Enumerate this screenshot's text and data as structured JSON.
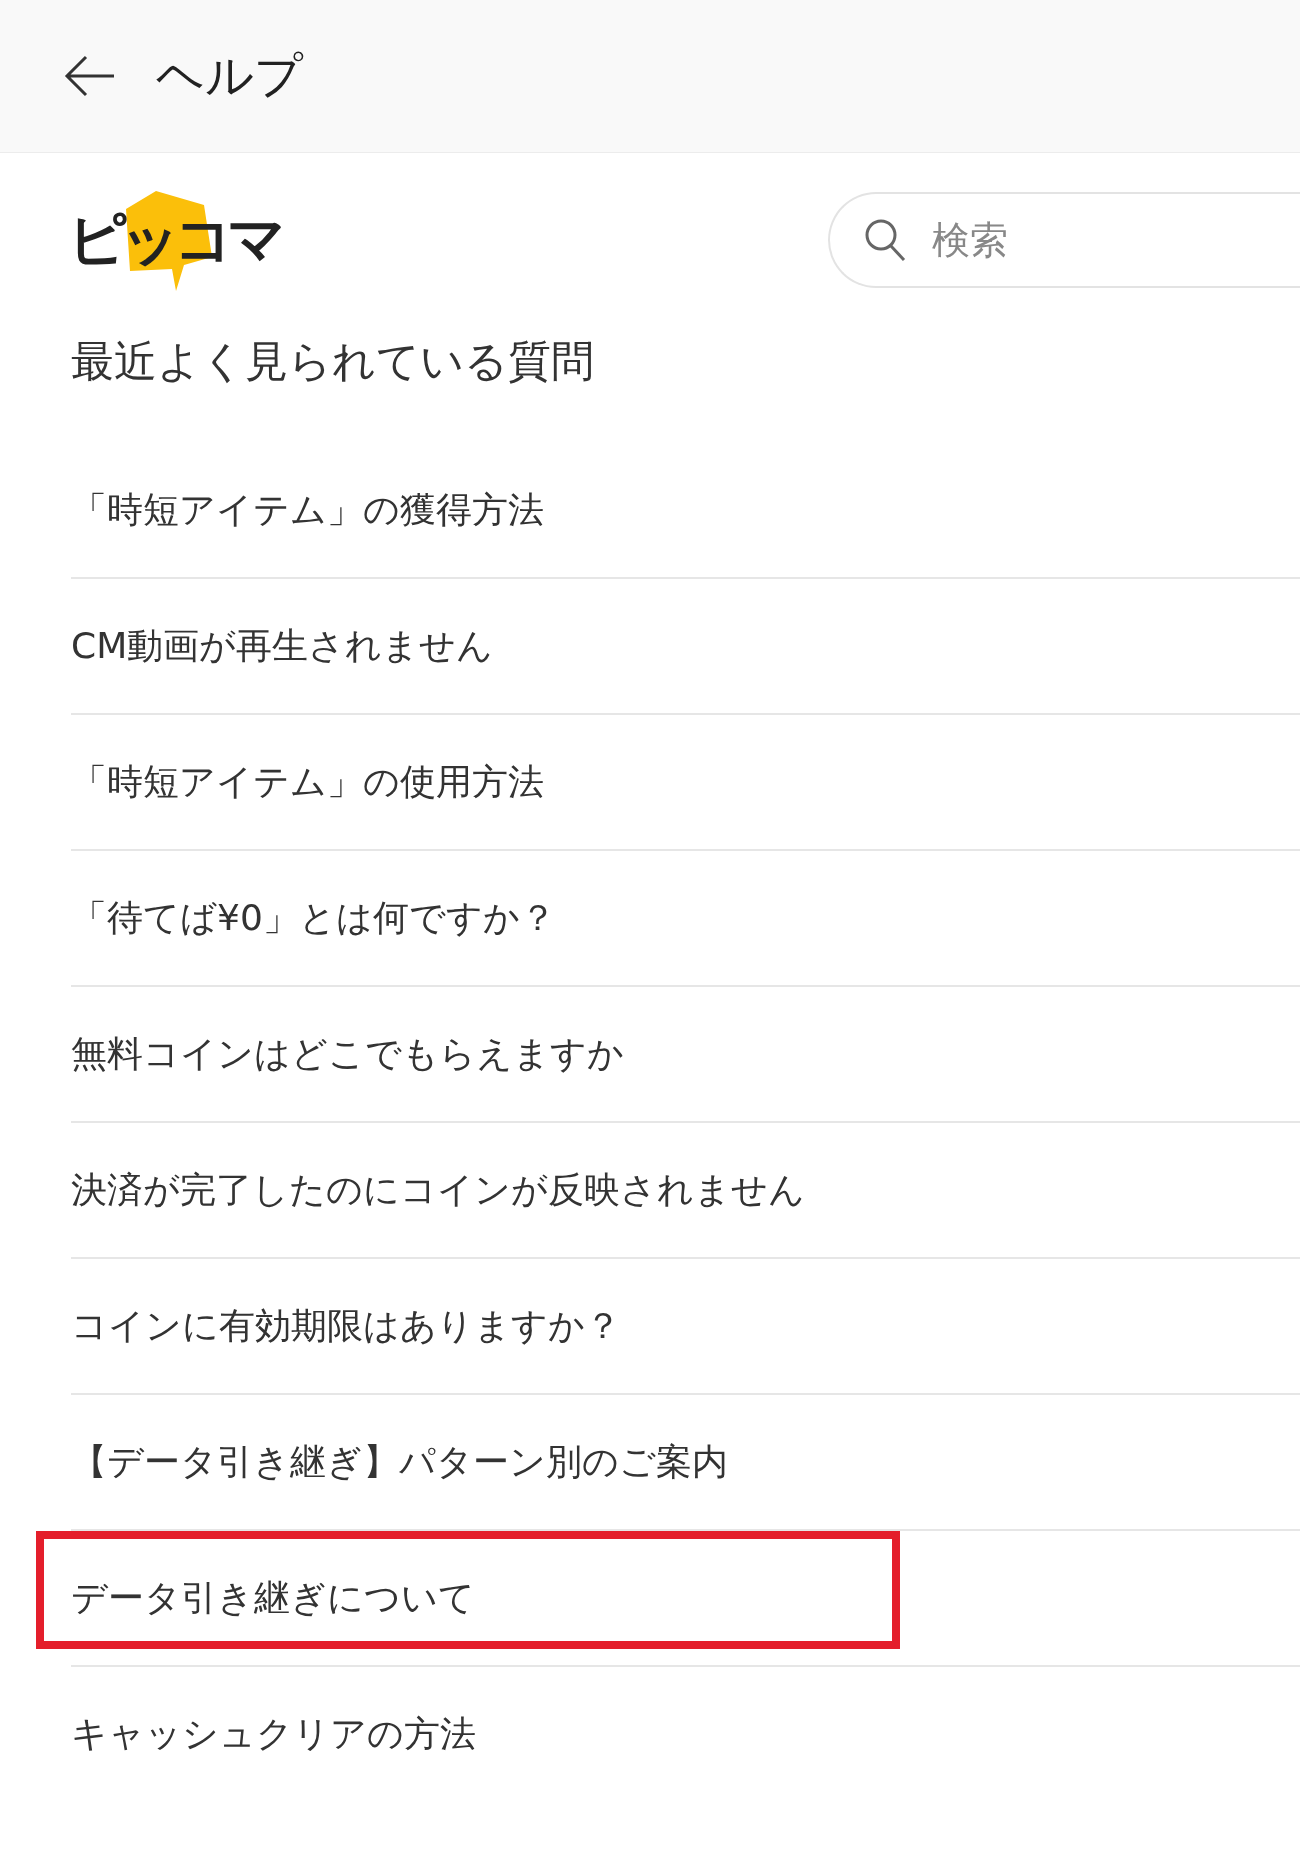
{
  "header": {
    "title": "ヘルプ"
  },
  "logo": {
    "text": "ピッコマ"
  },
  "search": {
    "placeholder": "検索"
  },
  "section": {
    "title": "最近よく見られている質問"
  },
  "questions": [
    {
      "text": "「時短アイテム」の獲得方法",
      "highlighted": false
    },
    {
      "text": "CM動画が再生されません",
      "highlighted": false
    },
    {
      "text": "「時短アイテム」の使用方法",
      "highlighted": false
    },
    {
      "text": "「待てば¥0」とは何ですか？",
      "highlighted": false
    },
    {
      "text": "無料コインはどこでもらえますか",
      "highlighted": false
    },
    {
      "text": "決済が完了したのにコインが反映されません",
      "highlighted": false
    },
    {
      "text": "コインに有効期限はありますか？",
      "highlighted": false
    },
    {
      "text": "【データ引き継ぎ】パターン別のご案内",
      "highlighted": false
    },
    {
      "text": "データ引き継ぎについて",
      "highlighted": true
    },
    {
      "text": "キャッシュクリアの方法",
      "highlighted": false
    }
  ]
}
